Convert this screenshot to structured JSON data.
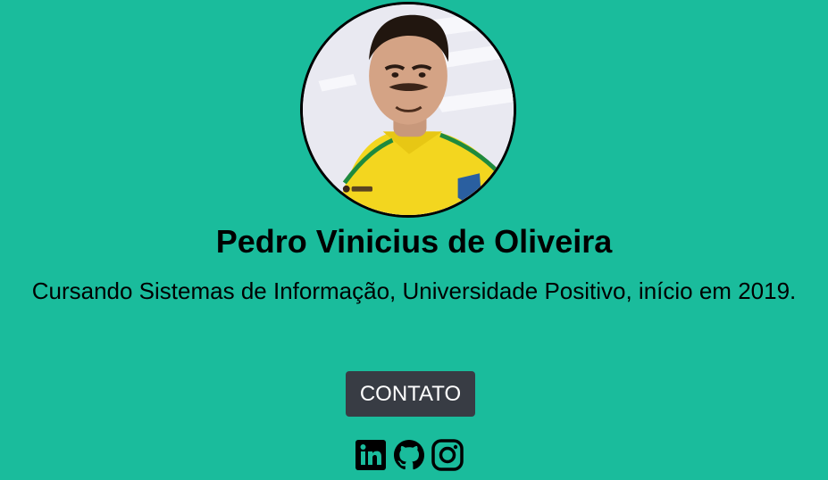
{
  "profile": {
    "name": "Pedro Vinicius de Oliveira",
    "bio": "Cursando Sistemas de Informação, Universidade Positivo, início em 2019.",
    "avatar_icon": "profile-photo"
  },
  "actions": {
    "contact_label": "CONTATO"
  },
  "social": {
    "items": [
      {
        "icon": "linkedin-icon"
      },
      {
        "icon": "github-icon"
      },
      {
        "icon": "instagram-icon"
      }
    ]
  },
  "colors": {
    "background": "#1abc9c",
    "button": "#383c44",
    "text": "#000000"
  }
}
